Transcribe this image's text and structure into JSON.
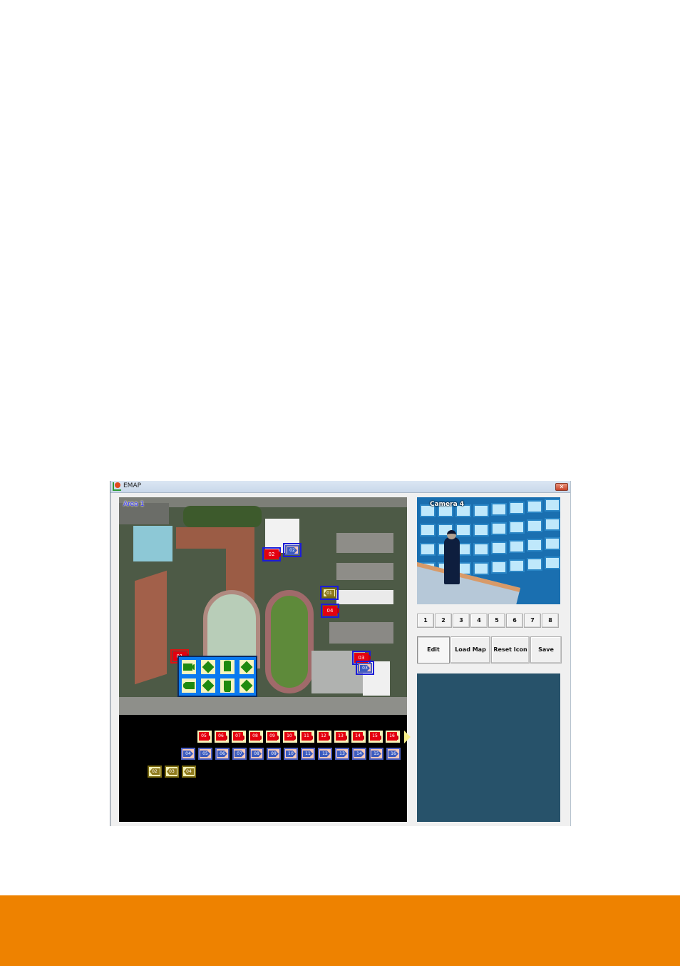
{
  "window": {
    "title": "EMAP",
    "app_icon": "emap-app-icon",
    "close_label": "✕"
  },
  "map": {
    "area_label": "Area 1",
    "placed_cameras": [
      {
        "type": "red",
        "label": "02",
        "selected": true
      },
      {
        "type": "blue",
        "label": "02",
        "selected": true
      },
      {
        "type": "gold",
        "label": "01",
        "selected": true
      },
      {
        "type": "red",
        "label": "04",
        "selected": true
      },
      {
        "type": "red",
        "label": "01",
        "selected": true
      },
      {
        "type": "red",
        "label": "03",
        "selected": true
      },
      {
        "type": "blue",
        "label": "03",
        "selected": true
      }
    ],
    "icon_picker": {
      "orientations": [
        "right",
        "down-right",
        "down",
        "down-left",
        "left",
        "up-left",
        "up",
        "up-right"
      ]
    }
  },
  "tray": {
    "red_cameras": [
      "05",
      "06",
      "07",
      "08",
      "09",
      "10",
      "11",
      "12",
      "13",
      "14",
      "15",
      "16"
    ],
    "blue_cameras": [
      "04",
      "05",
      "06",
      "07",
      "08",
      "09",
      "10",
      "11",
      "12",
      "13",
      "14",
      "15",
      "16"
    ],
    "gold_cameras": [
      "02",
      "03",
      "04"
    ],
    "more_arrow": "next-page-arrow"
  },
  "preview": {
    "camera_label": "Camera 4"
  },
  "channel_buttons": [
    "1",
    "2",
    "3",
    "4",
    "5",
    "6",
    "7",
    "8"
  ],
  "actions": {
    "edit": "Edit",
    "load_map": "Load Map",
    "reset_icon": "Reset Icon",
    "save": "Save"
  },
  "colors": {
    "footer": "#ee8200",
    "info_panel": "#27526a",
    "picker": "#0a7af0"
  }
}
